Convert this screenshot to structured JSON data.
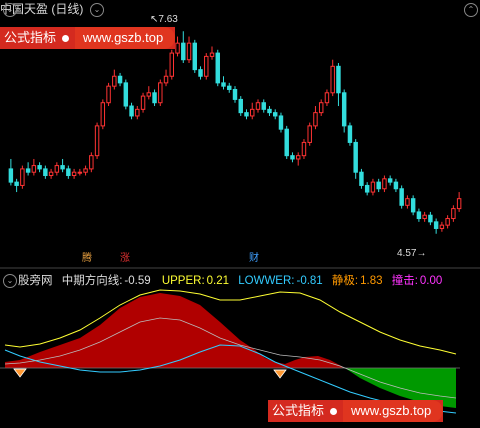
{
  "window": {
    "title": "中国天盈 (日线)"
  },
  "promo_top": {
    "label": "公式指标",
    "url": "www.gszb.top"
  },
  "promo_bottom": {
    "label": "公式指标",
    "url": "www.gszb.top"
  },
  "price_chart": {
    "high_label": "7.63",
    "low_label": "4.57",
    "markers": [
      {
        "text": "腾",
        "color": "#e8a040"
      },
      {
        "text": "涨",
        "color": "#e03030"
      },
      {
        "text": "财",
        "color": "#40a0ff"
      }
    ],
    "colors": {
      "up": "#ff3333",
      "down": "#33dddd"
    }
  },
  "indicator": {
    "name": "股旁网",
    "lines": [
      {
        "label": "中期方向线:",
        "value": "-0.59",
        "color": "#dddddd"
      },
      {
        "label": "UPPER:",
        "value": "0.21",
        "color": "#ffff33"
      },
      {
        "label": "LOWWER:",
        "value": "-0.81",
        "color": "#33ccff"
      },
      {
        "label": "静极:",
        "value": "1.83",
        "color": "#ff9900"
      },
      {
        "label": "撞击:",
        "value": "0.00",
        "color": "#ff33ff"
      }
    ],
    "colors": {
      "red_fill": "#b00000",
      "green_fill": "#009900",
      "yellow": "#ffff33",
      "cyan": "#33ccff",
      "diamond": "#ff9933"
    }
  },
  "chart_data": {
    "type": "candlestick",
    "y_range": [
      4.4,
      7.8
    ],
    "candles": [
      [
        5.55,
        5.35,
        5.7,
        5.3
      ],
      [
        5.35,
        5.3,
        5.4,
        5.2
      ],
      [
        5.3,
        5.55,
        5.6,
        5.25
      ],
      [
        5.55,
        5.5,
        5.65,
        5.45
      ],
      [
        5.5,
        5.6,
        5.7,
        5.45
      ],
      [
        5.6,
        5.55,
        5.65,
        5.5
      ],
      [
        5.55,
        5.45,
        5.6,
        5.4
      ],
      [
        5.45,
        5.5,
        5.55,
        5.4
      ],
      [
        5.5,
        5.6,
        5.65,
        5.45
      ],
      [
        5.6,
        5.55,
        5.7,
        5.5
      ],
      [
        5.55,
        5.45,
        5.6,
        5.4
      ],
      [
        5.45,
        5.5,
        5.55,
        5.4
      ],
      [
        5.5,
        5.5,
        5.55,
        5.45
      ],
      [
        5.5,
        5.55,
        5.6,
        5.45
      ],
      [
        5.55,
        5.75,
        5.8,
        5.5
      ],
      [
        5.75,
        6.2,
        6.25,
        5.7
      ],
      [
        6.2,
        6.55,
        6.6,
        6.15
      ],
      [
        6.55,
        6.8,
        6.85,
        6.5
      ],
      [
        6.8,
        6.95,
        7.05,
        6.75
      ],
      [
        6.95,
        6.85,
        7.0,
        6.8
      ],
      [
        6.85,
        6.5,
        6.9,
        6.45
      ],
      [
        6.5,
        6.35,
        6.55,
        6.3
      ],
      [
        6.35,
        6.45,
        6.5,
        6.3
      ],
      [
        6.45,
        6.65,
        6.7,
        6.4
      ],
      [
        6.65,
        6.7,
        6.8,
        6.6
      ],
      [
        6.7,
        6.55,
        6.75,
        6.5
      ],
      [
        6.55,
        6.85,
        6.9,
        6.5
      ],
      [
        6.85,
        6.95,
        7.05,
        6.8
      ],
      [
        6.95,
        7.3,
        7.35,
        6.9
      ],
      [
        7.3,
        7.45,
        7.55,
        7.25
      ],
      [
        7.45,
        7.2,
        7.63,
        7.15
      ],
      [
        7.2,
        7.45,
        7.55,
        7.15
      ],
      [
        7.45,
        7.05,
        7.5,
        7.0
      ],
      [
        7.05,
        6.95,
        7.1,
        6.9
      ],
      [
        6.95,
        7.25,
        7.3,
        6.9
      ],
      [
        7.25,
        7.3,
        7.4,
        7.2
      ],
      [
        7.3,
        6.85,
        7.35,
        6.8
      ],
      [
        6.85,
        6.8,
        6.95,
        6.75
      ],
      [
        6.8,
        6.75,
        6.85,
        6.7
      ],
      [
        6.75,
        6.6,
        6.8,
        6.55
      ],
      [
        6.6,
        6.4,
        6.65,
        6.35
      ],
      [
        6.4,
        6.35,
        6.45,
        6.3
      ],
      [
        6.35,
        6.45,
        6.55,
        6.3
      ],
      [
        6.45,
        6.55,
        6.6,
        6.4
      ],
      [
        6.55,
        6.45,
        6.6,
        6.4
      ],
      [
        6.45,
        6.4,
        6.5,
        6.35
      ],
      [
        6.4,
        6.35,
        6.45,
        6.3
      ],
      [
        6.35,
        6.15,
        6.4,
        6.1
      ],
      [
        6.15,
        5.75,
        6.2,
        5.7
      ],
      [
        5.75,
        5.7,
        5.8,
        5.65
      ],
      [
        5.7,
        5.75,
        5.8,
        5.6
      ],
      [
        5.75,
        5.95,
        6.0,
        5.7
      ],
      [
        5.95,
        6.2,
        6.25,
        5.9
      ],
      [
        6.2,
        6.4,
        6.5,
        6.15
      ],
      [
        6.4,
        6.55,
        6.6,
        6.35
      ],
      [
        6.55,
        6.7,
        6.75,
        6.5
      ],
      [
        6.7,
        7.1,
        7.2,
        6.65
      ],
      [
        7.1,
        6.7,
        7.15,
        6.5
      ],
      [
        6.7,
        6.2,
        6.75,
        6.1
      ],
      [
        6.2,
        5.95,
        6.25,
        5.9
      ],
      [
        5.95,
        5.5,
        6.0,
        5.4
      ],
      [
        5.5,
        5.3,
        5.55,
        5.25
      ],
      [
        5.3,
        5.2,
        5.35,
        5.15
      ],
      [
        5.2,
        5.35,
        5.4,
        5.15
      ],
      [
        5.35,
        5.25,
        5.4,
        5.2
      ],
      [
        5.25,
        5.4,
        5.45,
        5.2
      ],
      [
        5.4,
        5.35,
        5.45,
        5.3
      ],
      [
        5.35,
        5.25,
        5.4,
        5.2
      ],
      [
        5.25,
        5.0,
        5.3,
        4.95
      ],
      [
        5.0,
        5.1,
        5.15,
        4.95
      ],
      [
        5.1,
        4.9,
        5.15,
        4.85
      ],
      [
        4.9,
        4.8,
        4.95,
        4.75
      ],
      [
        4.8,
        4.85,
        4.9,
        4.75
      ],
      [
        4.85,
        4.75,
        4.9,
        4.7
      ],
      [
        4.75,
        4.65,
        4.8,
        4.57
      ],
      [
        4.65,
        4.7,
        4.75,
        4.6
      ],
      [
        4.7,
        4.8,
        4.85,
        4.65
      ],
      [
        4.8,
        4.95,
        5.0,
        4.75
      ],
      [
        4.95,
        5.1,
        5.2,
        4.9
      ]
    ]
  }
}
